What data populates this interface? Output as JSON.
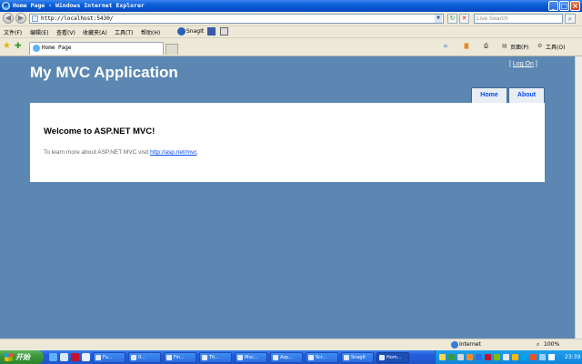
{
  "window": {
    "title": "Home Page - Windows Internet Explorer",
    "minimize": "_",
    "maximize": "□",
    "close": "×"
  },
  "address_bar": {
    "url": "http://localhost:5430/",
    "search_placeholder": "Live Search"
  },
  "menu": {
    "items": [
      "文件(F)",
      "编辑(E)",
      "查看(V)",
      "收藏夹(A)",
      "工具(T)",
      "帮助(H)"
    ],
    "snagit_label": "SnagIt"
  },
  "tabs": {
    "active_label": "Home Page",
    "commands": {
      "page": "页面(P)",
      "tools": "工具(O)"
    }
  },
  "site": {
    "title": "My MVC Application",
    "login_prefix": "[",
    "login_link": "Log On",
    "login_suffix": "]",
    "nav": [
      "Home",
      "About"
    ],
    "heading": "Welcome to ASP.NET MVC!",
    "body_text": "To learn more about ASP.NET MVC visit ",
    "body_link": "http://asp.net/mvc",
    "body_end": "."
  },
  "status_bar": {
    "zone": "Internet",
    "zoom": "100%"
  },
  "taskbar": {
    "start_label": "开始",
    "buttons": [
      "Fu...",
      "0...",
      "Fin...",
      "Tit...",
      "Mvc...",
      "Asp...",
      "Scr...",
      "SnagIt",
      "Hom..."
    ],
    "active_index": 8,
    "clock": "23:39"
  },
  "colors": {
    "page_background": "#5c87b2",
    "nav_link": "#034af3",
    "body_text": "#696969",
    "titlebar": "#0a5fd8",
    "taskbar": "#245edb"
  }
}
